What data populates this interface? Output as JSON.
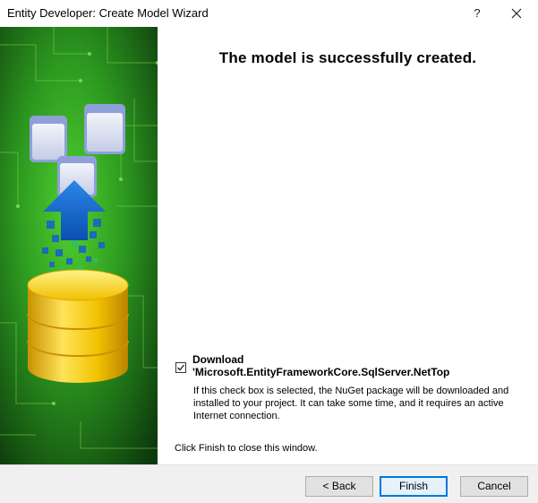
{
  "window": {
    "title": "Entity Developer: Create Model Wizard",
    "help_label": "?"
  },
  "content": {
    "heading": "The model is successfully created.",
    "download_checked": true,
    "download_label_line1": "Download",
    "download_label_line2": "'Microsoft.EntityFrameworkCore.SqlServer.NetTop",
    "download_description": "If this check box is selected, the NuGet package will be downloaded and installed to your project. It can take some time, and it requires an active Internet connection.",
    "finish_note": "Click Finish to close this window."
  },
  "buttons": {
    "back": "< Back",
    "finish": "Finish",
    "cancel": "Cancel"
  },
  "colors": {
    "art_green": "#2f8d2a",
    "database_gold": "#f2c200",
    "arrow_blue": "#1e7ad6",
    "default_button_border": "#0078d7"
  }
}
